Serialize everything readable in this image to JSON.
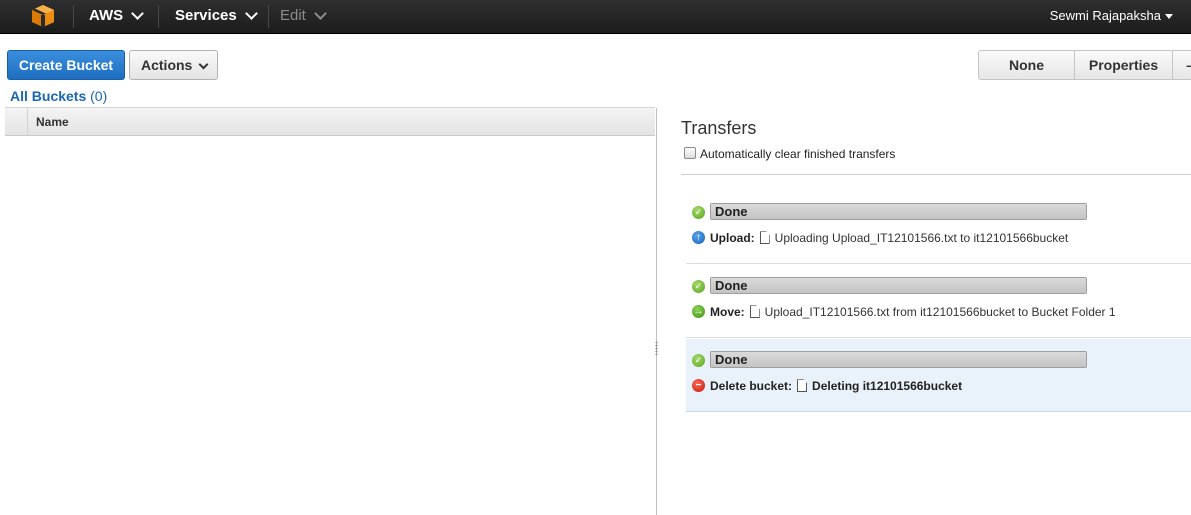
{
  "topbar": {
    "brand": "AWS",
    "services": "Services",
    "edit": "Edit",
    "user": "Sewmi Rajapaksha"
  },
  "toolbar": {
    "create_bucket": "Create Bucket",
    "actions": "Actions",
    "view_none": "None",
    "view_properties": "Properties"
  },
  "buckets": {
    "label": "All Buckets",
    "count": "(0)",
    "column_name": "Name"
  },
  "transfers": {
    "title": "Transfers",
    "auto_clear_label": "Automatically clear finished transfers",
    "auto_clear_checked": false,
    "items": [
      {
        "status": "Done",
        "progress": 1.0,
        "op_label": "Upload:",
        "op_icon": "upload-arrow-icon",
        "description": "Uploading Upload_IT12101566.txt to it12101566bucket"
      },
      {
        "status": "Done",
        "progress": 1.0,
        "op_label": "Move:",
        "op_icon": "move-arrow-icon",
        "description": "Upload_IT12101566.txt from it12101566bucket to Bucket Folder 1"
      },
      {
        "status": "Done",
        "progress": 1.0,
        "op_label": "Delete bucket:",
        "op_icon": "delete-icon",
        "description": "Deleting it12101566bucket"
      }
    ]
  },
  "colors": {
    "primary": "#1f6ec0",
    "link": "#1a66b8",
    "topbar": "#232323",
    "selected_row": "#e9f1fb"
  }
}
